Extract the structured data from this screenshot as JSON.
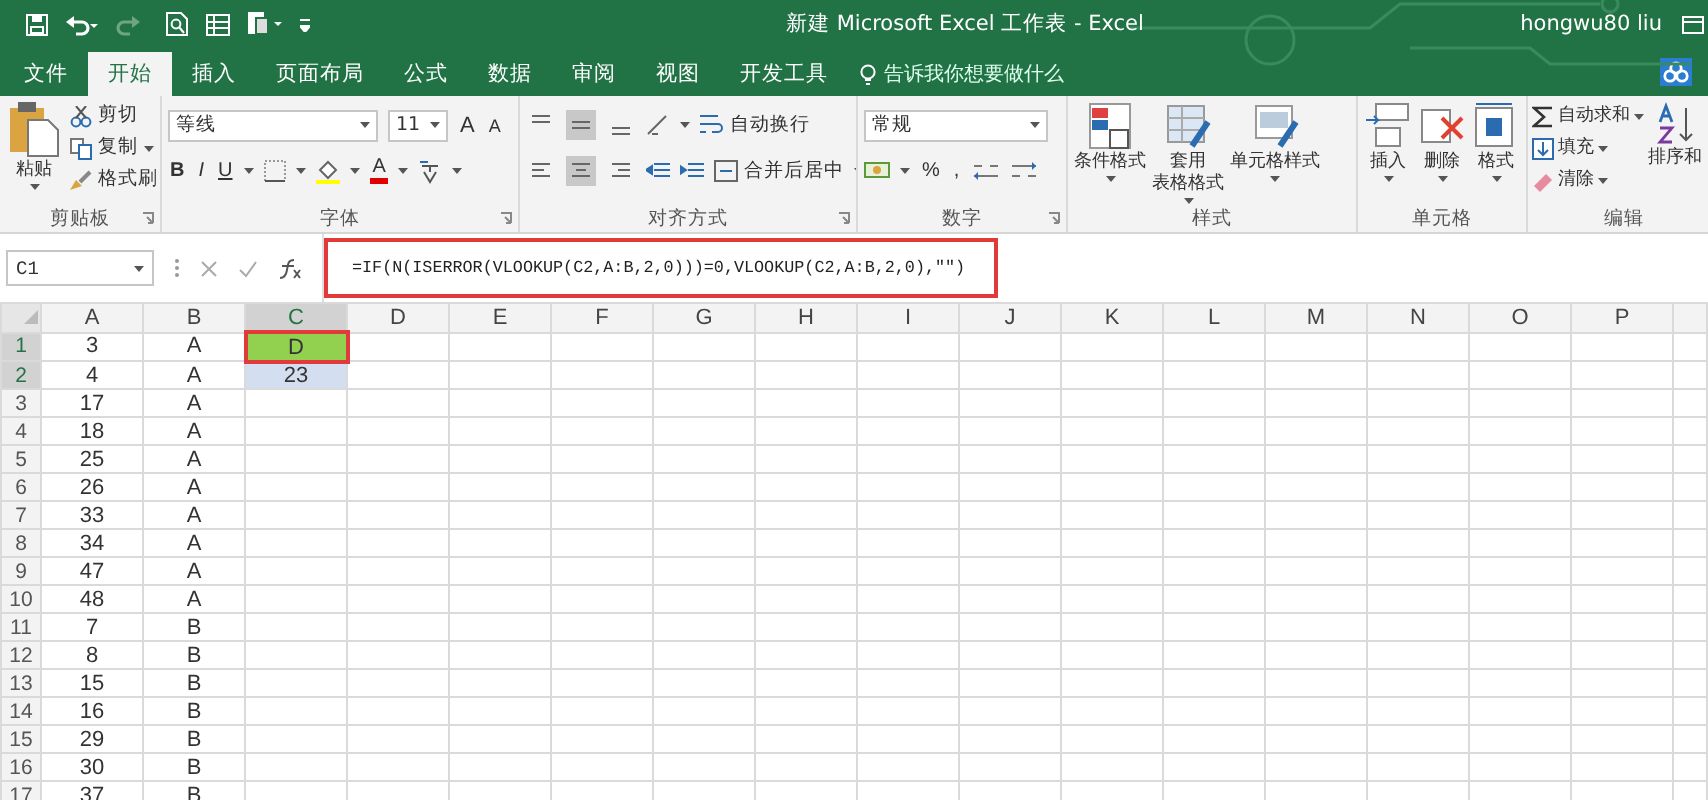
{
  "window": {
    "title": "新建 Microsoft Excel 工作表 - Excel",
    "user": "hongwu80 liu"
  },
  "tabs": [
    {
      "label": "文件",
      "selected": false
    },
    {
      "label": "开始",
      "selected": true
    },
    {
      "label": "插入",
      "selected": false
    },
    {
      "label": "页面布局",
      "selected": false
    },
    {
      "label": "公式",
      "selected": false
    },
    {
      "label": "数据",
      "selected": false
    },
    {
      "label": "审阅",
      "selected": false
    },
    {
      "label": "视图",
      "selected": false
    },
    {
      "label": "开发工具",
      "selected": false
    }
  ],
  "tell_me": {
    "placeholder": "告诉我你想要做什么"
  },
  "ribbon": {
    "clipboard": {
      "label": "剪贴板",
      "paste": "粘贴",
      "cut": "剪切",
      "copy": "复制",
      "format_painter": "格式刷"
    },
    "font": {
      "label": "字体",
      "font_name": "等线",
      "font_size": "11",
      "grow": "A",
      "shrink": "A",
      "bold": "B",
      "italic": "I",
      "underline": "U",
      "font_color": "A"
    },
    "alignment": {
      "label": "对齐方式",
      "vertical": [
        {
          "selected": false
        },
        {
          "selected": true
        },
        {
          "selected": false
        }
      ],
      "horizontal": [
        {
          "selected": false
        },
        {
          "selected": true
        },
        {
          "selected": false
        }
      ],
      "wrap_text": "自动换行",
      "merge_center": "合并后居中"
    },
    "number": {
      "label": "数字",
      "format": "常规",
      "percent": "%",
      "comma": ","
    },
    "styles": {
      "label": "样式",
      "buttons": [
        {
          "lines": [
            "条件格式"
          ]
        },
        {
          "lines": [
            "套用",
            "表格格式"
          ]
        },
        {
          "lines": [
            "单元格样式"
          ]
        }
      ]
    },
    "cells": {
      "label": "单元格",
      "buttons": [
        "插入",
        "删除",
        "格式"
      ]
    },
    "editing": {
      "label": "编辑",
      "autosum": "自动求和",
      "fill": "填充",
      "clear": "清除",
      "sort": "排序和"
    }
  },
  "name_box": {
    "value": "C1"
  },
  "formula_bar": {
    "value": "=IF(N(ISERROR(VLOOKUP(C2,A:B,2,0)))=0,VLOOKUP(C2,A:B,2,0),\"\")",
    "outlined": true
  },
  "columns": [
    {
      "label": "A",
      "selected": false
    },
    {
      "label": "B",
      "selected": false
    },
    {
      "label": "C",
      "selected": true
    },
    {
      "label": "D",
      "selected": false
    },
    {
      "label": "E",
      "selected": false
    },
    {
      "label": "F",
      "selected": false
    },
    {
      "label": "G",
      "selected": false
    },
    {
      "label": "H",
      "selected": false
    },
    {
      "label": "I",
      "selected": false
    },
    {
      "label": "J",
      "selected": false
    },
    {
      "label": "K",
      "selected": false
    },
    {
      "label": "L",
      "selected": false
    },
    {
      "label": "M",
      "selected": false
    },
    {
      "label": "N",
      "selected": false
    },
    {
      "label": "O",
      "selected": false
    },
    {
      "label": "P",
      "selected": false
    }
  ],
  "rows": [
    {
      "header": "1",
      "selected": true,
      "cells": [
        {
          "text": "3",
          "selected": false
        },
        {
          "text": "A",
          "selected": false
        },
        {
          "text": "D",
          "selected": true,
          "color": "#92d050",
          "outlined": true
        }
      ]
    },
    {
      "header": "2",
      "selected": true,
      "cells": [
        {
          "text": "4",
          "selected": false
        },
        {
          "text": "A",
          "selected": false
        },
        {
          "text": "23",
          "selected": true,
          "outlined": false
        }
      ]
    },
    {
      "header": "3",
      "selected": false,
      "cells": [
        {
          "text": "17",
          "selected": false
        },
        {
          "text": "A",
          "selected": false
        }
      ]
    },
    {
      "header": "4",
      "selected": false,
      "cells": [
        {
          "text": "18",
          "selected": false
        },
        {
          "text": "A",
          "selected": false
        }
      ]
    },
    {
      "header": "5",
      "selected": false,
      "cells": [
        {
          "text": "25",
          "selected": false
        },
        {
          "text": "A",
          "selected": false
        }
      ]
    },
    {
      "header": "6",
      "selected": false,
      "cells": [
        {
          "text": "26",
          "selected": false
        },
        {
          "text": "A",
          "selected": false
        }
      ]
    },
    {
      "header": "7",
      "selected": false,
      "cells": [
        {
          "text": "33",
          "selected": false
        },
        {
          "text": "A",
          "selected": false
        }
      ]
    },
    {
      "header": "8",
      "selected": false,
      "cells": [
        {
          "text": "34",
          "selected": false
        },
        {
          "text": "A",
          "selected": false
        }
      ]
    },
    {
      "header": "9",
      "selected": false,
      "cells": [
        {
          "text": "47",
          "selected": false
        },
        {
          "text": "A",
          "selected": false
        }
      ]
    },
    {
      "header": "10",
      "selected": false,
      "cells": [
        {
          "text": "48",
          "selected": false
        },
        {
          "text": "A",
          "selected": false
        }
      ]
    },
    {
      "header": "11",
      "selected": false,
      "cells": [
        {
          "text": "7",
          "selected": false
        },
        {
          "text": "B",
          "selected": false
        }
      ]
    },
    {
      "header": "12",
      "selected": false,
      "cells": [
        {
          "text": "8",
          "selected": false
        },
        {
          "text": "B",
          "selected": false
        }
      ]
    },
    {
      "header": "13",
      "selected": false,
      "cells": [
        {
          "text": "15",
          "selected": false
        },
        {
          "text": "B",
          "selected": false
        }
      ]
    },
    {
      "header": "14",
      "selected": false,
      "cells": [
        {
          "text": "16",
          "selected": false
        },
        {
          "text": "B",
          "selected": false
        }
      ]
    },
    {
      "header": "15",
      "selected": false,
      "cells": [
        {
          "text": "29",
          "selected": false
        },
        {
          "text": "B",
          "selected": false
        }
      ]
    },
    {
      "header": "16",
      "selected": false,
      "cells": [
        {
          "text": "30",
          "selected": false
        },
        {
          "text": "B",
          "selected": false
        }
      ]
    },
    {
      "header": "17",
      "selected": false,
      "cells": [
        {
          "text": "37",
          "selected": false
        },
        {
          "text": "B",
          "selected": false
        }
      ]
    }
  ]
}
